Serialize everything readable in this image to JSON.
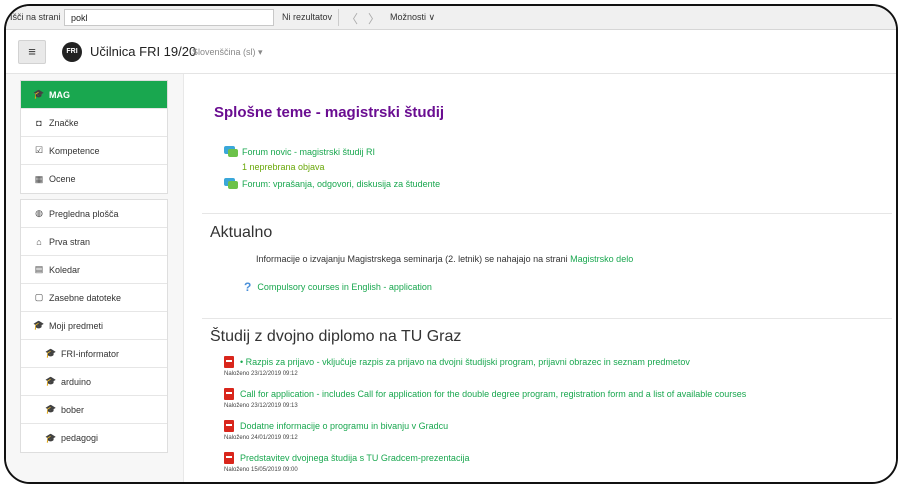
{
  "findbar": {
    "label": "Išči na strani",
    "query": "pokl",
    "results": "Ni rezultatov",
    "prev": "〈",
    "next": "〉",
    "options": "Možnosti ∨"
  },
  "navbar": {
    "menu_icon": "≡",
    "logo_text": "FRI",
    "site_name": "Učilnica FRI 19/20",
    "language": "Slovenščina (sl) ▾"
  },
  "sidebar": {
    "group1": [
      {
        "icon": "graduation-cap-icon",
        "glyph": "🎓",
        "label": "MAG",
        "active": true
      },
      {
        "icon": "shield-icon",
        "glyph": "◘",
        "label": "Značke"
      },
      {
        "icon": "checkbox-icon",
        "glyph": "☑",
        "label": "Kompetence"
      },
      {
        "icon": "table-icon",
        "glyph": "▦",
        "label": "Ocene"
      }
    ],
    "group2": [
      {
        "icon": "dashboard-icon",
        "glyph": "◍",
        "label": "Pregledna plošča"
      },
      {
        "icon": "home-icon",
        "glyph": "⌂",
        "label": "Prva stran"
      },
      {
        "icon": "calendar-icon",
        "glyph": "▤",
        "label": "Koledar"
      },
      {
        "icon": "file-icon",
        "glyph": "▢",
        "label": "Zasebne datoteke"
      },
      {
        "icon": "graduation-cap-icon",
        "glyph": "🎓",
        "label": "Moji predmeti"
      },
      {
        "icon": "graduation-cap-icon",
        "glyph": "🎓",
        "label": "FRI-informator",
        "sub": true
      },
      {
        "icon": "graduation-cap-icon",
        "glyph": "🎓",
        "label": "arduino",
        "sub": true
      },
      {
        "icon": "graduation-cap-icon",
        "glyph": "🎓",
        "label": "bober",
        "sub": true
      },
      {
        "icon": "graduation-cap-icon",
        "glyph": "🎓",
        "label": "pedagogi",
        "sub": true
      }
    ]
  },
  "main": {
    "general": {
      "title": "Splošne teme - magistrski študij",
      "forum_news": "Forum novic - magistrski študij RI",
      "unread": "1 neprebrana objava",
      "forum_discussion": "Forum: vprašanja, odgovori, diskusija za študente"
    },
    "aktualno": {
      "title": "Aktualno",
      "note_text": "Informacije o izvajanju Magistrskega seminarja (2. letnik) se nahajajo na strani",
      "note_link": "Magistrsko delo",
      "help_link": "Compulsory courses in English - application"
    },
    "dvojna": {
      "title": "Študij z dvojno diplomo na TU Graz",
      "resources": [
        {
          "label": "• Razpis za prijavo - vključuje razpis za prijavo na dvojni študijski program, prijavni obrazec in seznam predmetov",
          "meta": "Naloženo 23/12/2019 09:12"
        },
        {
          "label": "Call for application - includes Call for application for the double degree program, registration form and a list of available courses",
          "meta": "Naloženo 23/12/2019 09:13"
        },
        {
          "label": "Dodatne informacije o programu in bivanju v Gradcu",
          "meta": "Naloženo 24/01/2019 09:12"
        },
        {
          "label": "Predstavitev dvojnega študija s TU Gradcem-prezentacija",
          "meta": "Naloženo 15/05/2019 09:00"
        }
      ]
    }
  },
  "colors": {
    "accent_green": "#19a74f",
    "title_purple": "#6a0d91",
    "pdf_red": "#d9261c"
  }
}
